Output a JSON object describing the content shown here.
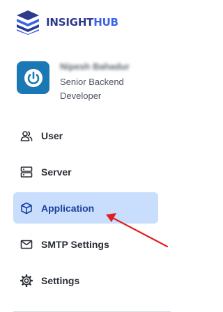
{
  "brand": {
    "name_part1": "INSIGHT",
    "name_part2": "HUB",
    "logo_icon": "stacked-layers-logo",
    "color_dark": "#2e3a8c",
    "color_accent": "#3a63e8"
  },
  "profile": {
    "name": "Nipesh Bahadur",
    "role": "Senior Backend Developer",
    "avatar_icon": "power-icon",
    "avatar_color": "#1a78b5"
  },
  "nav": {
    "items": [
      {
        "label": "User",
        "icon": "users-icon",
        "active": false
      },
      {
        "label": "Server",
        "icon": "server-icon",
        "active": false
      },
      {
        "label": "Application",
        "icon": "cube-icon",
        "active": true
      },
      {
        "label": "SMTP Settings",
        "icon": "mail-icon",
        "active": false
      },
      {
        "label": "Settings",
        "icon": "gear-icon",
        "active": false
      }
    ],
    "active_color": "#c9defd"
  },
  "annotation": {
    "type": "arrow",
    "color": "#e02020",
    "points_to": "Application"
  }
}
